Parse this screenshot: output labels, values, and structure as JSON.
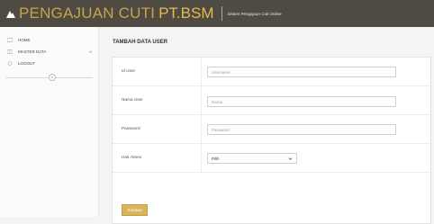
{
  "header": {
    "brand_main": "PENGAJUAN CUTI",
    "brand_accent": "PT.BSM",
    "tagline": "Sistem Pengajuan Cuti Online"
  },
  "sidebar": {
    "items": [
      {
        "label": "HOME",
        "icon": "home-icon"
      },
      {
        "label": "MASTER DATA",
        "icon": "grid-icon"
      },
      {
        "label": "LOGOUT",
        "icon": "power-icon"
      }
    ]
  },
  "main": {
    "title": "TAMBAH DATA USER",
    "fields": {
      "id_user": {
        "label": "Id User",
        "placeholder": "Username"
      },
      "nama_user": {
        "label": "Nama User",
        "placeholder": "Nama"
      },
      "password": {
        "label": "Password",
        "placeholder": "Password"
      },
      "hak_akses": {
        "label": "Hak Akses",
        "selected": "Pilih"
      }
    },
    "submit_label": "Simpan"
  },
  "colors": {
    "header_bg": "#4f4b43",
    "brand": "#c9a24a",
    "button": "#d9b45a"
  }
}
